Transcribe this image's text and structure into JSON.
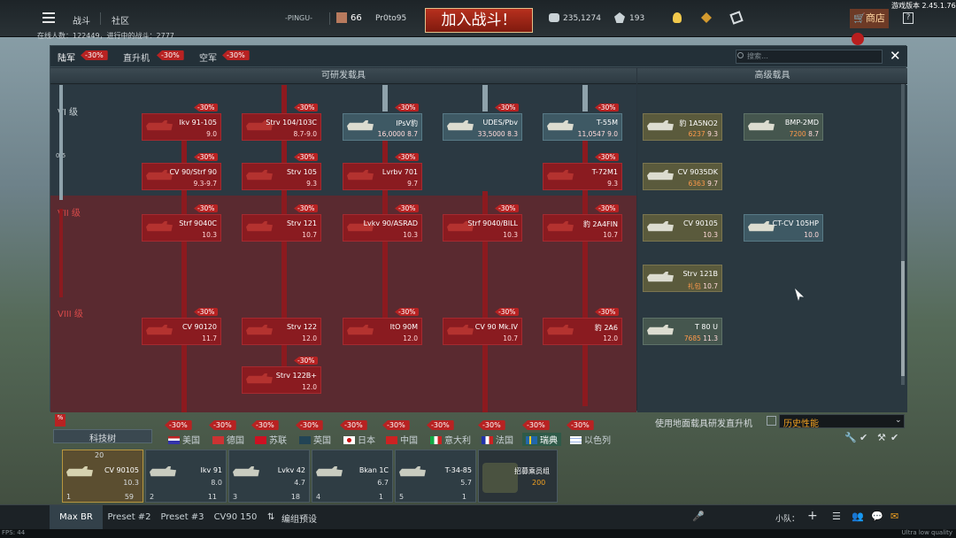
{
  "topbar": {
    "battle": "战斗",
    "community": "社区",
    "squad": "-PINGU-",
    "level": "66",
    "player": "Pr0to95",
    "play": "加入战斗！",
    "silver": "235,1274",
    "gold": "193",
    "shop": "商店",
    "version": "游戏版本 2.45.1.76",
    "online": "在线人数：122449，进行中的战斗：2777"
  },
  "tabs": {
    "ground": "陆军",
    "ground_disc": "-30%",
    "heli": "直升机",
    "heli_disc": "-30%",
    "air": "空军",
    "air_disc": "-30%"
  },
  "search_placeholder": "搜索…",
  "headers": {
    "research": "可研发载具",
    "premium": "高级载具"
  },
  "ranks": {
    "r6": "VI 级",
    "progress": "0/5",
    "r7": "VII 级",
    "r8": "VIII 级"
  },
  "cards": [
    {
      "name": "Ikv 91-105",
      "br": "9.0",
      "disc": "-30%"
    },
    {
      "name": "Strv 104/103C",
      "br": "8.7-9.0",
      "disc": "-30%"
    },
    {
      "name": "IPsV豹",
      "br": "16,0000 8.7",
      "disc": "-30%"
    },
    {
      "name": "UDES/Pbv",
      "br": "33,5000 8.3",
      "disc": "-30%"
    },
    {
      "name": "T-55M",
      "br": "11,0547 9.0",
      "disc": "-30%"
    },
    {
      "name": "CV 90/Strf 90",
      "br": "9.3-9.7",
      "disc": "-30%"
    },
    {
      "name": "Strv 105",
      "br": "9.3",
      "disc": "-30%"
    },
    {
      "name": "Lvrbv 701",
      "br": "9.7",
      "disc": "-30%"
    },
    {
      "name": "T-72M1",
      "br": "9.3",
      "disc": "-30%"
    },
    {
      "name": "Strf 9040C",
      "br": "10.3",
      "disc": "-30%"
    },
    {
      "name": "Strv 121",
      "br": "10.7",
      "disc": "-30%"
    },
    {
      "name": "Lvkv 90/ASRAD",
      "br": "10.3",
      "disc": "-30%"
    },
    {
      "name": "Strf 9040/BILL",
      "br": "10.3",
      "disc": "-30%"
    },
    {
      "name": "豹 2A4FIN",
      "br": "10.7",
      "disc": "-30%"
    },
    {
      "name": "CV 90120",
      "br": "11.7",
      "disc": "-30%"
    },
    {
      "name": "Strv 122",
      "br": "12.0",
      "disc": "-30%"
    },
    {
      "name": "ItO 90M",
      "br": "12.0",
      "disc": "-30%"
    },
    {
      "name": "CV 90 Mk.IV",
      "br": "10.7",
      "disc": "-30%"
    },
    {
      "name": "豹 2A6",
      "br": "12.0",
      "disc": "-30%"
    },
    {
      "name": "Strv 122B+",
      "br": "12.0",
      "disc": "-30%"
    }
  ],
  "premium": [
    {
      "name": "豹 1A5NO2",
      "cost": "6237",
      "br": "9.3"
    },
    {
      "name": "BMP-2MD",
      "cost": "7200",
      "br": "8.7"
    },
    {
      "name": "CV 9035DK",
      "cost": "6363",
      "br": "9.7"
    },
    {
      "name": "CV 90105",
      "cost": "",
      "br": "10.3"
    },
    {
      "name": "CT-CV 105HP",
      "cost": "",
      "br": "10.0"
    },
    {
      "name": "Strv 121B",
      "cost": "礼包",
      "br": "10.7"
    },
    {
      "name": "T 80 U",
      "cost": "7685",
      "br": "11.3"
    }
  ],
  "countries": [
    "美国",
    "德国",
    "苏联",
    "英国",
    "日本",
    "中国",
    "意大利",
    "法国",
    "瑞典",
    "以色列"
  ],
  "country_disc": "-30%",
  "techtree": "科技树",
  "research_heli": "使用地面载具研发直升机",
  "history": "历史性能",
  "crew": [
    {
      "name": "CV 90105",
      "br": "10.3",
      "idx": "1",
      "count": "59"
    },
    {
      "name": "Ikv 91",
      "br": "8.0",
      "idx": "2",
      "count": "11"
    },
    {
      "name": "Lvkv 42",
      "br": "4.7",
      "idx": "3",
      "count": "18"
    },
    {
      "name": "Bkan 1C",
      "br": "6.7",
      "idx": "4",
      "count": "1"
    },
    {
      "name": "T-34-85",
      "br": "5.7",
      "idx": "5",
      "count": "1"
    }
  ],
  "recruit": {
    "label": "招募乘员组",
    "cost": "200"
  },
  "presets": [
    "Max BR",
    "Preset #2",
    "Preset #3",
    "CV90 150"
  ],
  "edit_preset": "编组预设",
  "squad_label": "小队：",
  "fps": "FPS: 44",
  "quality": "Ultra low quality"
}
